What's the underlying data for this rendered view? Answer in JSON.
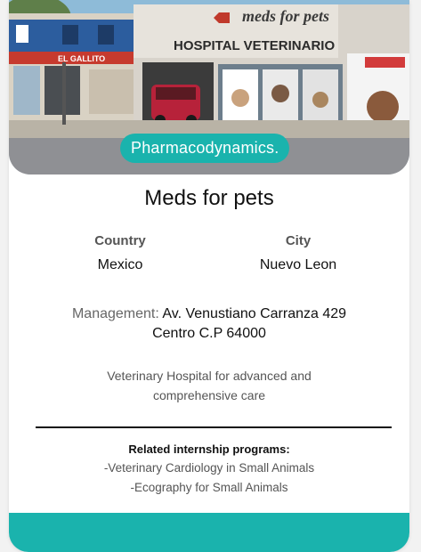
{
  "photo": {
    "badge": "Pharmacodynamics.",
    "sign_top": "meds for pets",
    "sign_bottom": "HOSPITAL VETERINARIO",
    "shop_sign": "EL GALLITO",
    "brand_color": "#1ab3ad"
  },
  "hospital": {
    "name": "Meds for pets",
    "country_label": "Country",
    "country": "Mexico",
    "city_label": "City",
    "city": "Nuevo Leon",
    "management_label": "Management:",
    "management_line1": "Av. Venustiano Carranza 429",
    "management_line2": "Centro C.P 64000",
    "description": "Veterinary Hospital for advanced and comprehensive care"
  },
  "programs": {
    "title": "Related internship programs:",
    "items": [
      "-Veterinary Cardiology in Small Animals",
      "-Ecography for Small Animals"
    ]
  }
}
